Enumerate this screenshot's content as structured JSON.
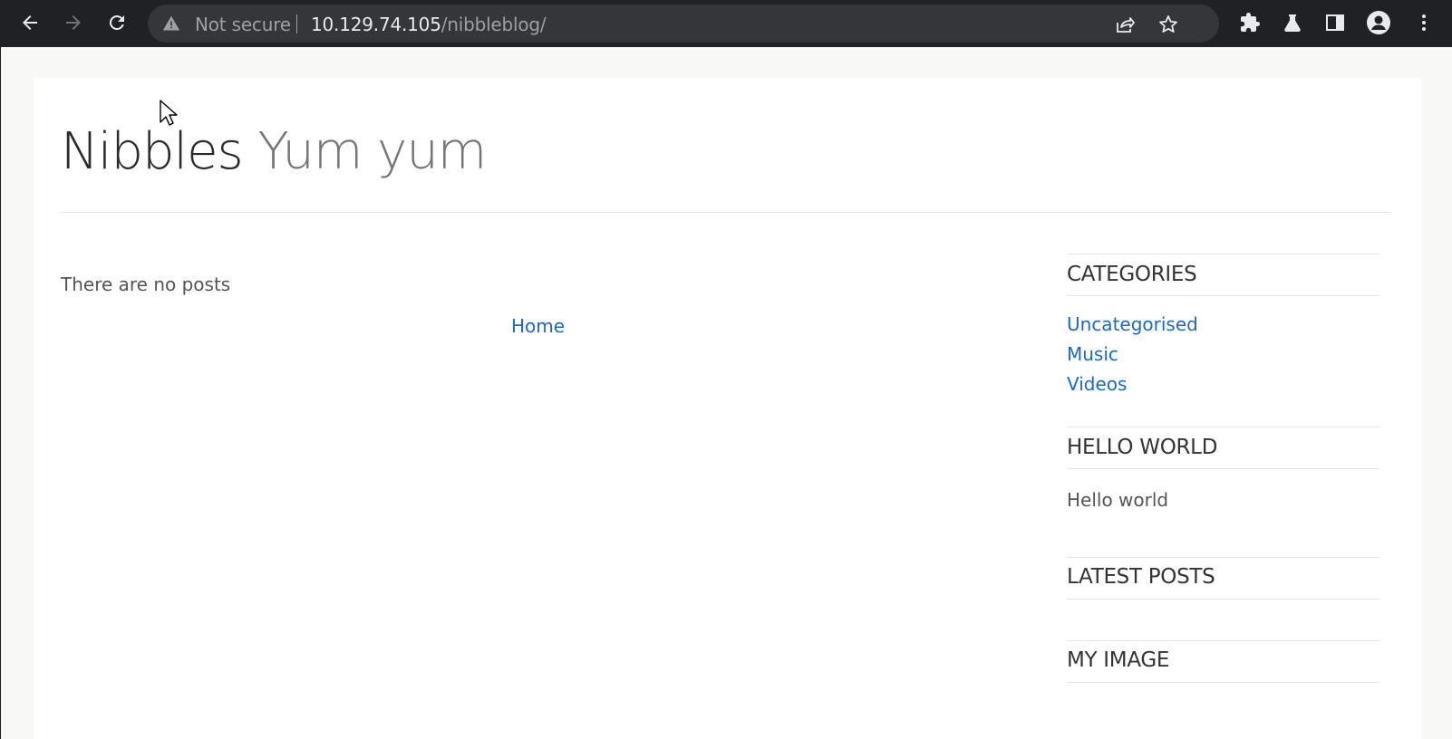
{
  "browser": {
    "security_label": "Not secure",
    "url_host": "10.129.74.105",
    "url_path": "/nibbleblog/"
  },
  "blog": {
    "name": "Nibbles",
    "slogan": "Yum yum",
    "no_posts_text": "There are no posts",
    "home_link": "Home"
  },
  "sidebar": {
    "categories_title": "CATEGORIES",
    "categories": [
      "Uncategorised",
      "Music",
      "Videos"
    ],
    "hello_title": "HELLO WORLD",
    "hello_text": "Hello world",
    "latest_title": "LATEST POSTS",
    "image_title": "MY IMAGE"
  },
  "colors": {
    "link": "#1e69c0",
    "toolbar": "#202124",
    "omnibox": "#35363a"
  }
}
